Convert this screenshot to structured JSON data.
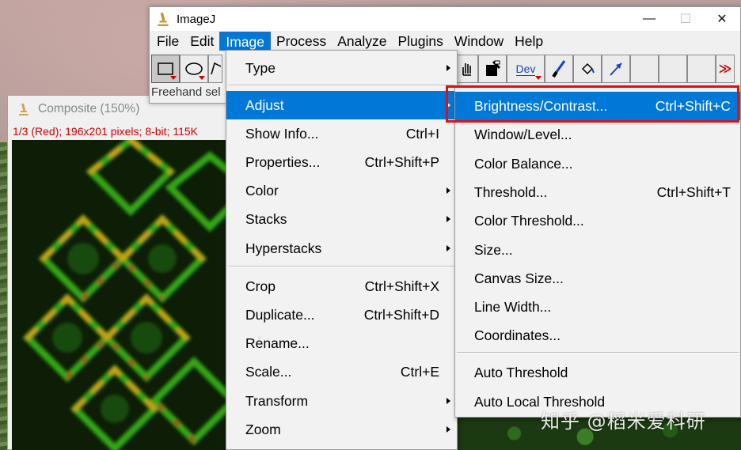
{
  "main_window": {
    "title": "ImageJ",
    "menu": [
      "File",
      "Edit",
      "Image",
      "Process",
      "Analyze",
      "Plugins",
      "Window",
      "Help"
    ],
    "active_menu": "Image",
    "status": "Freehand sel",
    "tools_right": {
      "dev_label": "Dev",
      "more_icon": "≫"
    },
    "controls": {
      "minimize": "—",
      "maximize": "☐",
      "close": "✕"
    }
  },
  "image_window": {
    "title": "Composite (150%)",
    "info": "1/3 (Red); 196x201 pixels; 8-bit; 115K"
  },
  "image_menu": {
    "items": [
      {
        "label": "Type",
        "shortcut": "",
        "submenu": true
      },
      {
        "label": "Adjust",
        "shortcut": "",
        "submenu": true,
        "active": true
      },
      {
        "label": "Show Info...",
        "shortcut": "Ctrl+I"
      },
      {
        "label": "Properties...",
        "shortcut": "Ctrl+Shift+P"
      },
      {
        "label": "Color",
        "shortcut": "",
        "submenu": true
      },
      {
        "label": "Stacks",
        "shortcut": "",
        "submenu": true
      },
      {
        "label": "Hyperstacks",
        "shortcut": "",
        "submenu": true
      },
      {
        "label": "Crop",
        "shortcut": "Ctrl+Shift+X"
      },
      {
        "label": "Duplicate...",
        "shortcut": "Ctrl+Shift+D"
      },
      {
        "label": "Rename...",
        "shortcut": ""
      },
      {
        "label": "Scale...",
        "shortcut": "Ctrl+E"
      },
      {
        "label": "Transform",
        "shortcut": "",
        "submenu": true
      },
      {
        "label": "Zoom",
        "shortcut": "",
        "submenu": true
      }
    ]
  },
  "adjust_menu": {
    "items": [
      {
        "label": "Brightness/Contrast...",
        "shortcut": "Ctrl+Shift+C",
        "active": true
      },
      {
        "label": "Window/Level...",
        "shortcut": ""
      },
      {
        "label": "Color Balance...",
        "shortcut": ""
      },
      {
        "label": "Threshold...",
        "shortcut": "Ctrl+Shift+T"
      },
      {
        "label": "Color Threshold...",
        "shortcut": ""
      },
      {
        "label": "Size...",
        "shortcut": ""
      },
      {
        "label": "Canvas Size...",
        "shortcut": ""
      },
      {
        "label": "Line Width...",
        "shortcut": ""
      },
      {
        "label": "Coordinates...",
        "shortcut": ""
      },
      {
        "label": "Auto Threshold",
        "shortcut": ""
      },
      {
        "label": "Auto Local Threshold",
        "shortcut": ""
      }
    ]
  },
  "watermark": "知乎 @稻米爱科研",
  "colors": {
    "menu_highlight": "#0078d7",
    "annotation_box": "#e01010",
    "info_text": "#d00000"
  }
}
